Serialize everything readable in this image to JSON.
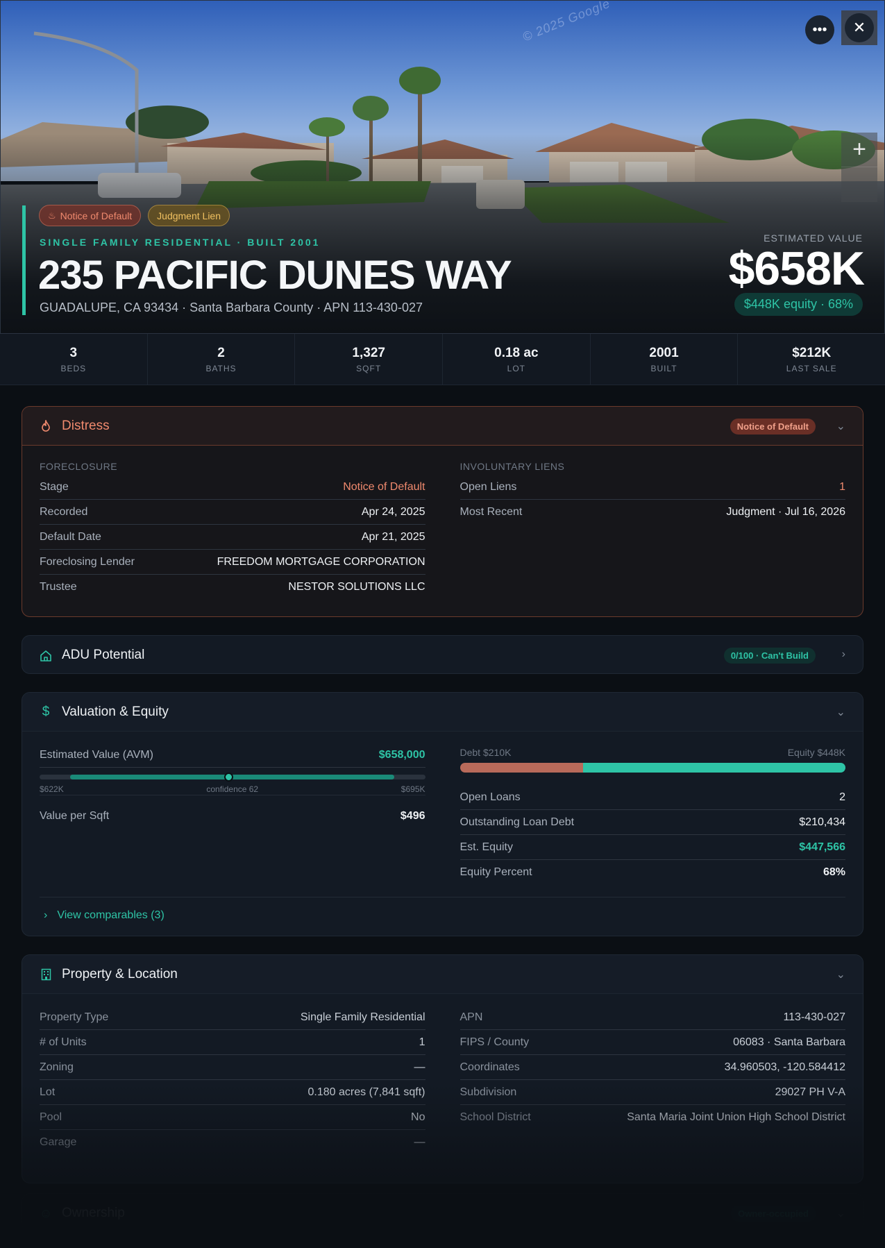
{
  "hero": {
    "watermark": "© 2025 Google",
    "more_icon": "more-horizontal-icon",
    "close_icon": "close-icon",
    "zoom_in_label": "+",
    "badges": [
      {
        "label": "Notice of Default",
        "icon": "flame-icon"
      },
      {
        "label": "Judgment Lien"
      }
    ],
    "subtitle": "SINGLE FAMILY RESIDENTIAL · BUILT 2001",
    "title": "235 PACIFIC DUNES WAY",
    "address_line": "GUADALUPE, CA 93434 · Santa Barbara County · APN 113-430-027",
    "estimated_value_label": "ESTIMATED VALUE",
    "estimated_value": "$658K",
    "equity_pill": "$448K equity · 68%"
  },
  "stats": [
    {
      "value": "3",
      "label": "BEDS"
    },
    {
      "value": "2",
      "label": "BATHS"
    },
    {
      "value": "1,327",
      "label": "SQFT"
    },
    {
      "value": "0.18 ac",
      "label": "LOT"
    },
    {
      "value": "2001",
      "label": "BUILT"
    },
    {
      "value": "$212K",
      "label": "LAST SALE"
    }
  ],
  "distress": {
    "title": "Distress",
    "icon": "flame-icon",
    "badge": "Notice of Default",
    "foreclosure_label": "FORECLOSURE",
    "foreclosure": [
      {
        "k": "Stage",
        "v": "Notice of Default"
      },
      {
        "k": "Recorded",
        "v": "Apr 24, 2025"
      },
      {
        "k": "Default Date",
        "v": "Apr 21, 2025"
      },
      {
        "k": "Foreclosing Lender",
        "v": "FREEDOM MORTGAGE CORPORATION"
      },
      {
        "k": "Trustee",
        "v": "NESTOR SOLUTIONS LLC"
      }
    ],
    "liens_label": "INVOLUNTARY LIENS",
    "liens": [
      {
        "k": "Open Liens",
        "v": "1"
      },
      {
        "k": "Most Recent",
        "v": "Judgment · Jul 16, 2026"
      }
    ]
  },
  "adu": {
    "title": "ADU Potential",
    "icon": "home-icon",
    "badge": "0/100 · Can't Build"
  },
  "valuation": {
    "title": "Valuation & Equity",
    "icon": "dollar-icon",
    "avm_label": "Estimated Value (AVM)",
    "avm_value": "$658,000",
    "range_low": "$622K",
    "range_high": "$695K",
    "confidence": "confidence 62",
    "range_position": 0.49,
    "value_per_sqft_label": "Value per Sqft",
    "value_per_sqft": "$496",
    "debt_label": "Debt $210K",
    "equity_label": "Equity $448K",
    "equity_fraction": 0.68,
    "loans": [
      {
        "k": "Open Loans",
        "v": "2"
      },
      {
        "k": "Outstanding Loan Debt",
        "v": "$210,434"
      },
      {
        "k": "Est. Equity",
        "v": "$447,566"
      },
      {
        "k": "Equity Percent",
        "v": "68%"
      }
    ],
    "comparables_label": "View comparables (3)"
  },
  "property": {
    "title": "Property & Location",
    "icon": "building-icon",
    "left": [
      {
        "k": "Property Type",
        "v": "Single Family Residential"
      },
      {
        "k": "# of Units",
        "v": "1"
      },
      {
        "k": "Zoning",
        "v": "—"
      },
      {
        "k": "Lot",
        "v": "0.180 acres (7,841 sqft)"
      },
      {
        "k": "Pool",
        "v": "No"
      },
      {
        "k": "Garage",
        "v": "—"
      }
    ],
    "right": [
      {
        "k": "APN",
        "v": "113-430-027"
      },
      {
        "k": "FIPS / County",
        "v": "06083 · Santa Barbara"
      },
      {
        "k": "Coordinates",
        "v": "34.960503, -120.584412"
      },
      {
        "k": "Subdivision",
        "v": "29027 PH V-A"
      },
      {
        "k": "School District",
        "v": "Santa Maria Joint Union High School District"
      }
    ]
  },
  "ownership": {
    "title": "Ownership",
    "icon": "user-icon",
    "badge": "Owner-occupied"
  },
  "colors": {
    "accent": "#2ec4a6",
    "distress": "#f08a6e",
    "lien": "#f0c060",
    "debt": "#b86a5a"
  }
}
